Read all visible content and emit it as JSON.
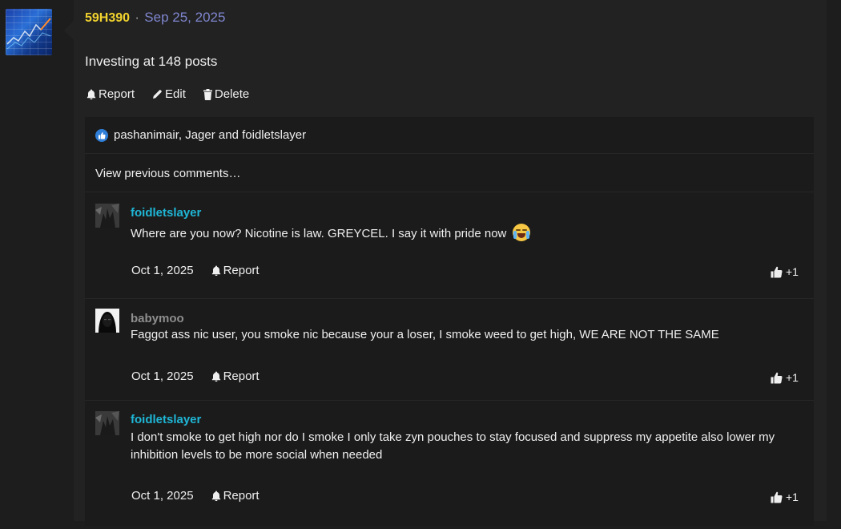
{
  "post": {
    "username": "59H390",
    "separator": "·",
    "date": "Sep 25, 2025",
    "body": "Investing at 148 posts",
    "actions": {
      "report": "Report",
      "edit": "Edit",
      "delete": "Delete"
    }
  },
  "likes": {
    "text": "pashanimair, Jager and foidletslayer"
  },
  "view_previous": "View previous comments…",
  "comments": [
    {
      "author": "foidletslayer",
      "text": "Where are you now? Nicotine is law. GREYCEL. I say it with pride now",
      "date": "Oct 1, 2025",
      "report": "Report",
      "reaction": "+1"
    },
    {
      "author": "babymoo",
      "text": "Faggot ass nic user, you smoke nic because your a loser, I smoke weed to get high, WE ARE NOT THE SAME",
      "date": "Oct 1, 2025",
      "report": "Report",
      "reaction": "+1"
    },
    {
      "author": "foidletslayer",
      "text": "I don't smoke to get high nor do I smoke I only take zyn pouches to stay focused and suppress my appetite also lower my inhibition levels to be more social when needed",
      "date": "Oct 1, 2025",
      "report": "Report",
      "reaction": "+1"
    }
  ],
  "colors": {
    "username": "#f1d32e",
    "date": "#7f86cf",
    "comment_author": "#1fb6d6",
    "comment_author_muted": "#8e8e8e"
  }
}
